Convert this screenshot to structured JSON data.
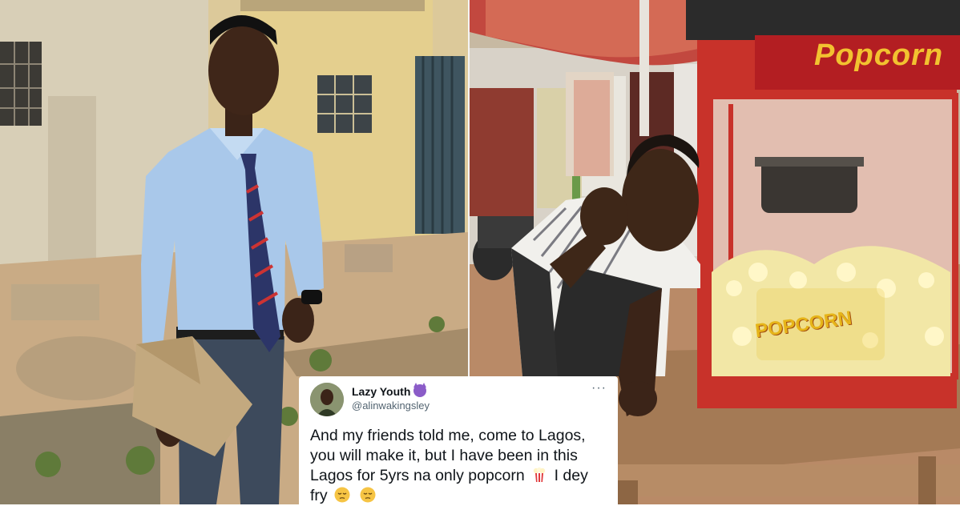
{
  "tweet": {
    "display_name": "Lazy Youth",
    "name_emoji": "smiling-devil-emoji",
    "handle": "@alinwakingsley",
    "more_label": "···",
    "text_lines": [
      "And my friends told me, come to Lagos,",
      "you will make it, but I have been in this",
      "Lagos for 5yrs na only popcorn",
      "I dey",
      "fry"
    ],
    "inline_emojis": [
      "popcorn-emoji",
      "pensive-face-emoji",
      "pensive-face-emoji"
    ]
  },
  "right_photo": {
    "machine_sign": "Popcorn",
    "machine_logo": "POPCORN"
  },
  "colors": {
    "text": "#0f1419",
    "secondary_text": "#536471",
    "machine_red": "#c8322a",
    "shirt_blue": "#a9c8ea"
  }
}
